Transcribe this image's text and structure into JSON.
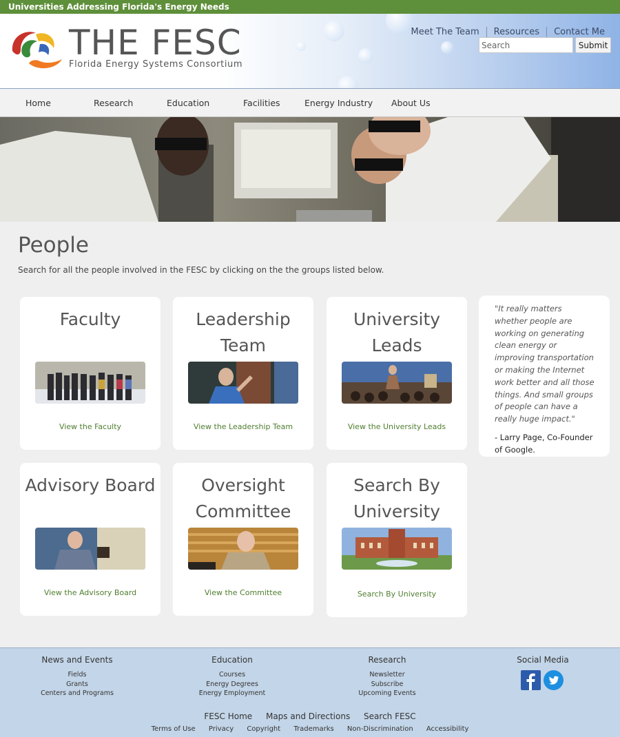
{
  "topbar": {
    "tagline": "Universities Addressing Florida's Energy Needs"
  },
  "header": {
    "logo_title": "THE FESC",
    "logo_subtitle": "Florida Energy Systems Consortium",
    "utility_nav": [
      "Meet The Team",
      "Resources",
      "Contact Me"
    ],
    "search": {
      "placeholder": "Search",
      "submit_label": "Submit"
    }
  },
  "nav": {
    "items": [
      "Home",
      "Research",
      "Education",
      "Facilities",
      "Energy Industry",
      "About Us"
    ]
  },
  "main": {
    "title": "People",
    "intro": "Search for all the people involved in the FESC by clicking on the the groups listed below.",
    "cards": [
      {
        "title": "Faculty",
        "link": "View the Faculty"
      },
      {
        "title": "Leadership Team",
        "link": "View the Leadership Team"
      },
      {
        "title": "University Leads",
        "link": "View the University Leads"
      },
      {
        "title": "Advisory Board",
        "link": "View the Advisory Board"
      },
      {
        "title": "Oversight Committee",
        "link": "View the Committee"
      },
      {
        "title": "Search By University",
        "link": "Search By University"
      }
    ],
    "quote": {
      "text": "\"It really matters whether people are working on generating clean energy or improving transportation or making the Internet work better and all those things. And small groups of people can have a really huge impact.\"",
      "author": "- Larry Page, Co-Founder of Google."
    }
  },
  "footer": {
    "columns": [
      {
        "heading": "News and Events",
        "links": [
          "Fields",
          "Grants",
          "Centers and Programs"
        ]
      },
      {
        "heading": "Education",
        "links": [
          "Courses",
          "Energy Degrees",
          "Energy Employment"
        ]
      },
      {
        "heading": "Research",
        "links": [
          "Newsletter",
          "Subscribe",
          "Upcoming Events"
        ]
      },
      {
        "heading": "Social Media",
        "links": []
      }
    ],
    "social": [
      "facebook-icon",
      "twitter-icon"
    ],
    "main_links": [
      "FESC Home",
      "Maps and Directions",
      "Search FESC"
    ],
    "legal_links": [
      "Terms of Use",
      "Privacy",
      "Copyright",
      "Trademarks",
      "Non-Discrimination",
      "Accessibility"
    ]
  },
  "colors": {
    "topbar": "#5e8f3a",
    "link_green": "#4f7d2e",
    "footer_bg": "#c3d5e8",
    "page_bg": "#efefef"
  }
}
